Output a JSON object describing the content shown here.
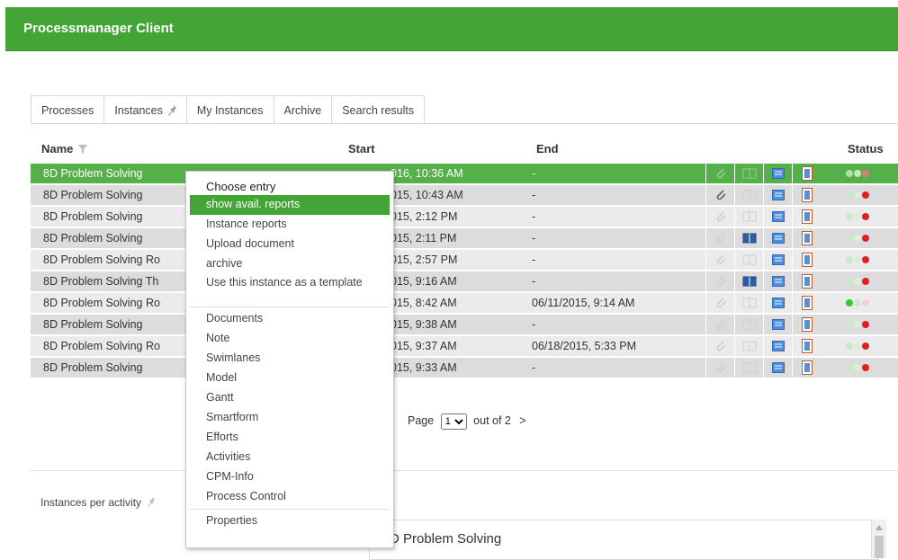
{
  "app": {
    "title": "Processmanager Client"
  },
  "tabs": [
    "Processes",
    "Instances",
    "My Instances",
    "Archive",
    "Search results"
  ],
  "columns": {
    "name": "Name",
    "start": "Start",
    "end": "End",
    "status": "Status"
  },
  "rows": [
    {
      "name": "8D Problem Solving",
      "start": "016, 10:36 AM",
      "end": "-"
    },
    {
      "name": "8D Problem Solving",
      "start": "015, 10:43 AM",
      "end": "-"
    },
    {
      "name": "8D Problem Solving",
      "start": "015, 2:12 PM",
      "end": "-"
    },
    {
      "name": "8D Problem Solving",
      "start": "015, 2:11 PM",
      "end": "-"
    },
    {
      "name": "8D Problem Solving Ro",
      "start": "015, 2:57 PM",
      "end": "-"
    },
    {
      "name": "8D Problem Solving Th",
      "start": "015, 9:16 AM",
      "end": "-"
    },
    {
      "name": "8D Problem Solving Ro",
      "start": "015, 8:42 AM",
      "end": "06/11/2015, 9:14 AM"
    },
    {
      "name": "8D Problem Solving",
      "start": "015, 9:38 AM",
      "end": "-"
    },
    {
      "name": "8D Problem Solving Ro",
      "start": "015, 9:37 AM",
      "end": "06/18/2015, 5:33 PM"
    },
    {
      "name": "8D Problem Solving",
      "start": "015, 9:33 AM",
      "end": "-"
    }
  ],
  "pager": {
    "prefix": "Page",
    "page": "1",
    "suffix": "out of 2",
    "next": ">"
  },
  "context_menu": {
    "header": "Choose entry",
    "items_a": [
      "show avail. reports",
      "Instance reports",
      "Upload document",
      "archive",
      "Use this instance as a template"
    ],
    "items_b": [
      "Documents",
      "Note",
      "Swimlanes",
      "Model",
      "Gantt",
      "Smartform",
      "Efforts",
      "Activities",
      "CPM-Info",
      "Process Control"
    ],
    "items_c": [
      "Properties"
    ]
  },
  "instances_per_activity": {
    "label": "Instances per activity",
    "selected": "D Problem Solving"
  },
  "colors": {
    "brand": "#43a535",
    "selected_row": "#55b049",
    "status_green": "#2ecc2e",
    "status_red": "#e02020",
    "status_faded": "#c8eac8"
  }
}
